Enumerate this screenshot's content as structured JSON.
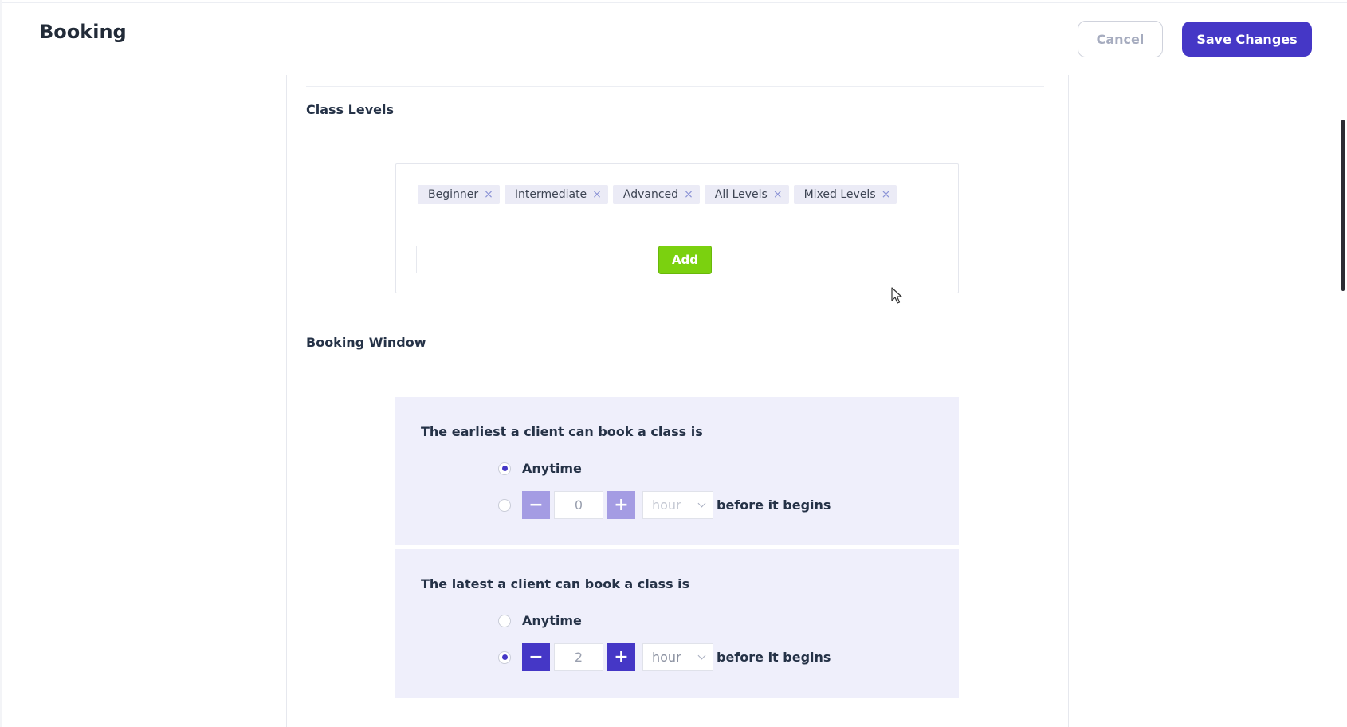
{
  "header": {
    "title": "Booking",
    "cancel_label": "Cancel",
    "save_label": "Save Changes"
  },
  "class_levels": {
    "heading": "Class Levels",
    "chips": [
      {
        "label": "Beginner"
      },
      {
        "label": "Intermediate"
      },
      {
        "label": "Advanced"
      },
      {
        "label": "All Levels"
      },
      {
        "label": "Mixed Levels"
      }
    ],
    "remove_glyph": "×",
    "input_value": "",
    "add_label": "Add"
  },
  "booking_window": {
    "heading": "Booking Window",
    "earliest": {
      "question": "The earliest a client can book a class is",
      "anytime_label": "Anytime",
      "anytime_selected": true,
      "minus_glyph": "−",
      "plus_glyph": "+",
      "amount": "0",
      "unit": "hour",
      "suffix": "before it begins"
    },
    "latest": {
      "question": "The latest a client can book a class is",
      "anytime_label": "Anytime",
      "anytime_selected": false,
      "minus_glyph": "−",
      "plus_glyph": "+",
      "amount": "2",
      "unit": "hour",
      "suffix": "before it begins"
    }
  },
  "colors": {
    "primary": "#4537c6",
    "add_green": "#7bd10f",
    "card_bg": "#efeffb",
    "chip_bg": "#ebebf6"
  }
}
